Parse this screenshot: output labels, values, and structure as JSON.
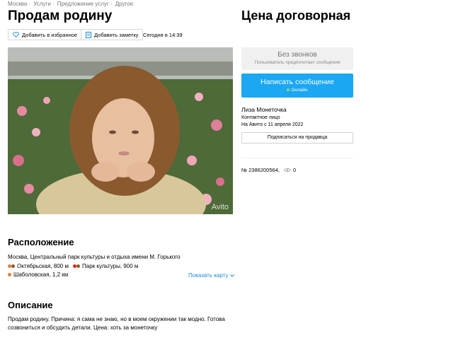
{
  "breadcrumbs": [
    "Москва",
    "Услуги",
    "Предложение услуг",
    "Другое"
  ],
  "title": "Продам родину",
  "actions": {
    "favorite_label": "Добавить в избранное",
    "note_label": "Добавить заметку",
    "date": "Сегодня в 14:39"
  },
  "photo": {
    "watermark": "Avito"
  },
  "price": "Цена договорная",
  "contact": {
    "no_calls": "Без звонков",
    "no_calls_sub": "Пользователь предпочитает сообщения",
    "message_button": "Написать сообщение",
    "online_status": "Онлайн"
  },
  "seller": {
    "name": "Лиза Монеточка",
    "role": "Контактное лицо",
    "since": "На Авито с 11 апреля 2022",
    "subscribe_label": "Подписаться на продавца"
  },
  "ad": {
    "number": "№ 2386200564,",
    "views": "0"
  },
  "location": {
    "heading": "Расположение",
    "address": "Москва, Центральный парк культуры и отдыха имени М. Горького",
    "metro": [
      {
        "name": "Октябрьская, 800 м",
        "colors": [
          "#f07e24",
          "#8d5b2d"
        ]
      },
      {
        "name": "Парк культуры, 900 м",
        "colors": [
          "#e42313",
          "#8d5b2d"
        ]
      },
      {
        "name": "Шаболовская, 1,2 км",
        "colors": [
          "#f07e24"
        ]
      }
    ],
    "map_link": "Показать карту"
  },
  "description": {
    "heading": "Описание",
    "line1": "Продам родину. Причина: я сама не знаю, но в моем окружении так модно. Готова",
    "line2": "созвониться и обсудить детали. Цена: хоть за монеточку"
  }
}
